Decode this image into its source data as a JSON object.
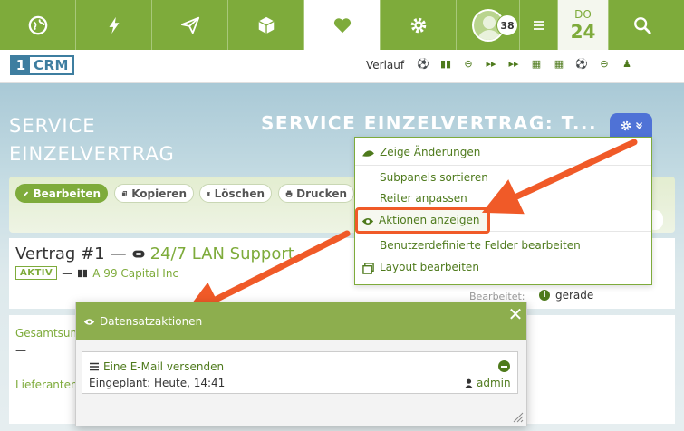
{
  "nav": {
    "items": [
      {
        "icon": "globe-icon"
      },
      {
        "icon": "lightning-icon"
      },
      {
        "icon": "paper-plane-icon"
      },
      {
        "icon": "cube-icon"
      },
      {
        "icon": "heart-icon",
        "active": true
      },
      {
        "icon": "gear-icon"
      }
    ],
    "notification_count": "38",
    "menu_icon": "hamburger-icon",
    "calendar_day_name": "DO",
    "calendar_day_number": "24",
    "search_icon": "search-icon"
  },
  "subbar": {
    "logo_number": "1",
    "logo_text": "CRM",
    "history_label": "Verlauf"
  },
  "header": {
    "module_title_line1": "SERVICE",
    "module_title_line2": "EINZELVERTRAG",
    "record_title": "SERVICE EINZELVERTRAG: T..."
  },
  "actions": {
    "edit": "Bearbeiten",
    "copy": "Kopieren",
    "delete": "Löschen",
    "print": "Drucken"
  },
  "record": {
    "name": "Vertrag #1",
    "separator": "—",
    "linked_name": "24/7 LAN Support",
    "status": "AKTIV",
    "account": "A 99 Capital Inc",
    "edited_label": "Bearbeitet:",
    "edited_value": "gerade"
  },
  "lower": {
    "label1": "Gesamtsum",
    "value1": "—",
    "label2": "Lieferanten"
  },
  "dropdown": {
    "items": [
      "Zeige Änderungen",
      "Subpanels sortieren",
      "Reiter anpassen",
      "Aktionen anzeigen",
      "Benutzerdefinierte Felder bearbeiten",
      "Layout bearbeiten"
    ]
  },
  "dialog": {
    "title": "Datensatzaktionen",
    "task_title": "Eine E-Mail versenden",
    "task_planned": "Eingeplant: Heute, 14:41",
    "task_user": "admin"
  },
  "colors": {
    "brand_green": "#7eab3b",
    "accent_blue": "#4f72d6",
    "highlight_orange": "#f05a28"
  }
}
